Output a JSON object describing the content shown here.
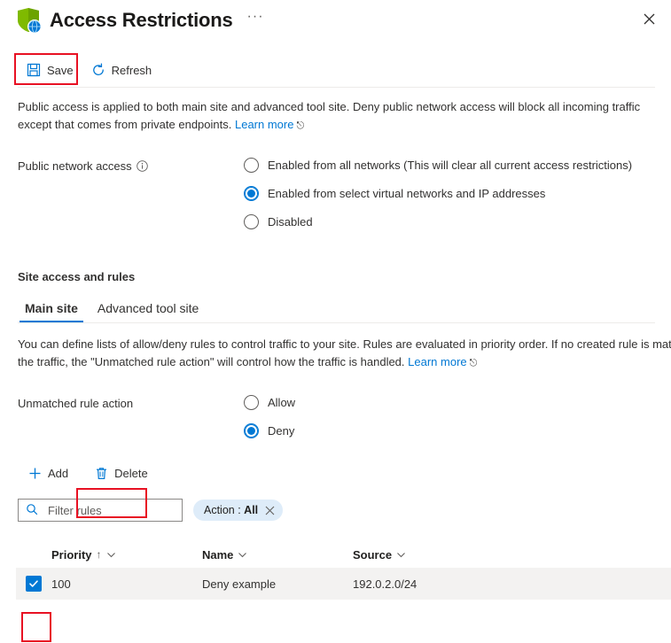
{
  "header": {
    "title": "Access Restrictions",
    "icon": "shield-globe-icon",
    "ellipsis": "···",
    "close_icon": "close-icon"
  },
  "toolbar": {
    "save_label": "Save",
    "refresh_label": "Refresh"
  },
  "public_access": {
    "description_line1": "Public access is applied to both main site and advanced tool site. Deny public network access will block all incoming traffic",
    "description_line2": "except that comes from private endpoints.",
    "learn_more": "Learn more",
    "label": "Public network access",
    "options": [
      {
        "label": "Enabled from all networks (This will clear all current access restrictions)",
        "selected": false
      },
      {
        "label": "Enabled from select virtual networks and IP addresses",
        "selected": true
      },
      {
        "label": "Disabled",
        "selected": false
      }
    ]
  },
  "site_section": {
    "title": "Site access and rules",
    "tabs": [
      {
        "label": "Main site",
        "active": true
      },
      {
        "label": "Advanced tool site",
        "active": false
      }
    ],
    "description_line1": "You can define lists of allow/deny rules to control traffic to your site. Rules are evaluated in priority order. If no created rule is mat",
    "description_line2": "the traffic, the \"Unmatched rule action\" will control how the traffic is handled.",
    "learn_more": "Learn more",
    "unmatched_label": "Unmatched rule action",
    "unmatched_options": [
      {
        "label": "Allow",
        "selected": false
      },
      {
        "label": "Deny",
        "selected": true
      }
    ]
  },
  "rules_toolbar": {
    "add_label": "Add",
    "delete_label": "Delete"
  },
  "filter": {
    "placeholder": "Filter rules",
    "value": "",
    "pill_label": "Action : ",
    "pill_value": "All"
  },
  "table": {
    "columns": [
      {
        "label": "Priority",
        "sorted": "↑"
      },
      {
        "label": "Name",
        "sorted": ""
      },
      {
        "label": "Source",
        "sorted": ""
      }
    ],
    "rows": [
      {
        "selected": true,
        "priority": "100",
        "name": "Deny example",
        "source": "192.0.2.0/24"
      }
    ]
  },
  "colors": {
    "accent": "#0078d4",
    "annotation": "#e81123",
    "row_selected_bg": "#f3f2f1",
    "pill_bg": "#deecf9"
  }
}
